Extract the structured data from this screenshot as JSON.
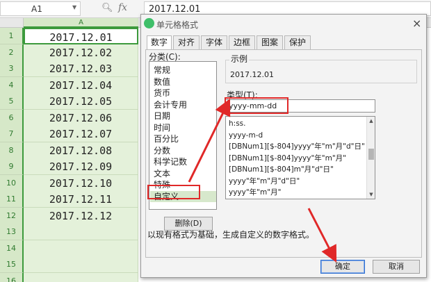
{
  "formula_bar": {
    "cell_ref": "A1",
    "zoom_icon": "magnifier-icon",
    "fx_label": "fx",
    "value": "2017.12.01"
  },
  "sheet": {
    "column_a": "A",
    "rows": [
      {
        "num": "1",
        "value": "2017.12.01"
      },
      {
        "num": "2",
        "value": "2017.12.02"
      },
      {
        "num": "3",
        "value": "2017.12.03"
      },
      {
        "num": "4",
        "value": "2017.12.04"
      },
      {
        "num": "5",
        "value": "2017.12.05"
      },
      {
        "num": "6",
        "value": "2017.12.06"
      },
      {
        "num": "7",
        "value": "2017.12.07"
      },
      {
        "num": "8",
        "value": "2017.12.08"
      },
      {
        "num": "9",
        "value": "2017.12.09"
      },
      {
        "num": "10",
        "value": "2017.12.10"
      },
      {
        "num": "11",
        "value": "2017.12.11"
      },
      {
        "num": "12",
        "value": "2017.12.12"
      },
      {
        "num": "13",
        "value": ""
      },
      {
        "num": "14",
        "value": ""
      },
      {
        "num": "15",
        "value": ""
      },
      {
        "num": "16",
        "value": ""
      }
    ]
  },
  "dialog": {
    "title": "单元格格式",
    "close": "×",
    "tabs": [
      "数字",
      "对齐",
      "字体",
      "边框",
      "图案",
      "保护"
    ],
    "category_label": "分类(C):",
    "categories": [
      "常规",
      "数值",
      "货币",
      "会计专用",
      "日期",
      "时间",
      "百分比",
      "分数",
      "科学记数",
      "文本",
      "特殊",
      "自定义"
    ],
    "delete_button": "删除(D)",
    "sample_label": "示例",
    "sample_value": "2017.12.01",
    "type_label": "类型(T):",
    "type_value": "yyyy-mm-dd",
    "format_list": [
      "h:ss.",
      "yyyy-m-d",
      "[DBNum1][$-804]yyyy\"年\"m\"月\"d\"日\"",
      "[DBNum1][$-804]yyyy\"年\"m\"月\"",
      "[DBNum1][$-804]m\"月\"d\"日\"",
      "yyyy\"年\"m\"月\"d\"日\"",
      "yyyy\"年\"m\"月\""
    ],
    "description": "以现有格式为基础，生成自定义的数字格式。",
    "ok_button": "确定",
    "cancel_button": "取消"
  },
  "colors": {
    "highlight": "#e02828",
    "selection_green": "#3c9a3c"
  }
}
